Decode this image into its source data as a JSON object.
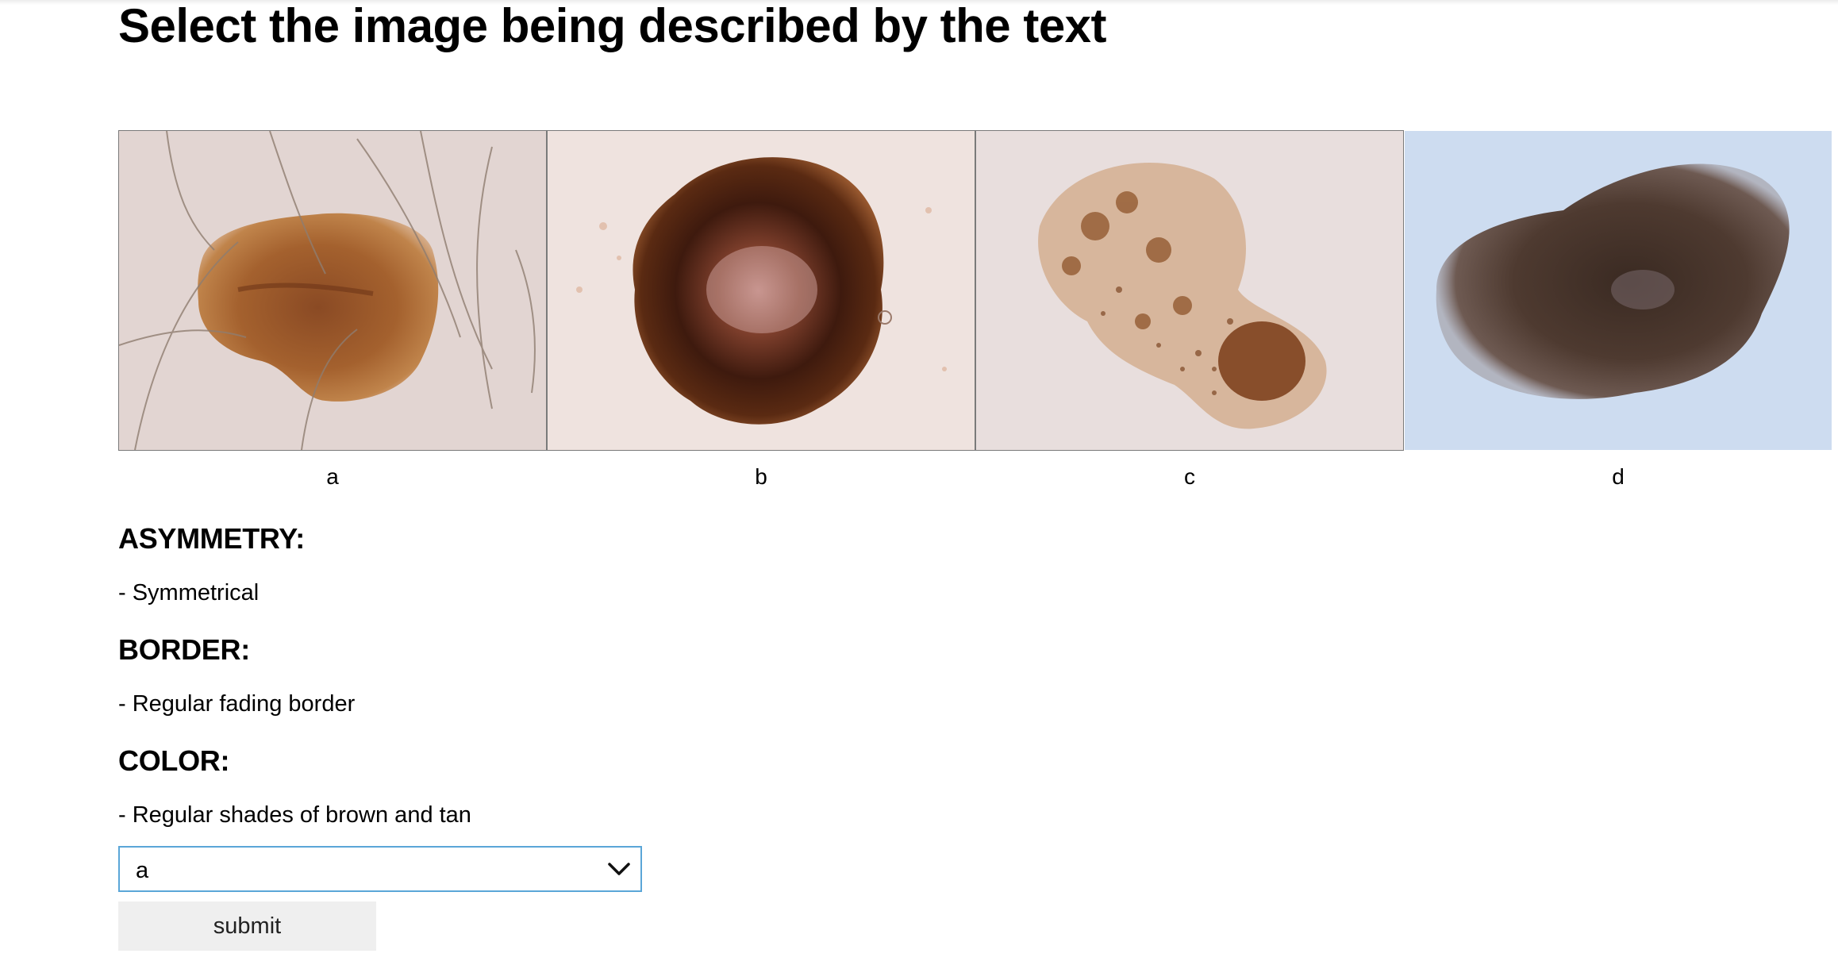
{
  "page": {
    "title": "Select the image being described by the text"
  },
  "options": [
    {
      "label": "a"
    },
    {
      "label": "b"
    },
    {
      "label": "c"
    },
    {
      "label": "d"
    }
  ],
  "criteria": [
    {
      "heading": "ASYMMETRY:",
      "value": "- Symmetrical"
    },
    {
      "heading": "BORDER:",
      "value": "- Regular fading border"
    },
    {
      "heading": "COLOR:",
      "value": "- Regular shades of brown and tan"
    }
  ],
  "form": {
    "selected_option": "a",
    "submit_label": "submit"
  },
  "icons": {
    "select_arrow": "chevron-down-icon"
  },
  "colors": {
    "select_focus_border": "#5aa6d8",
    "submit_background": "#efefef"
  }
}
